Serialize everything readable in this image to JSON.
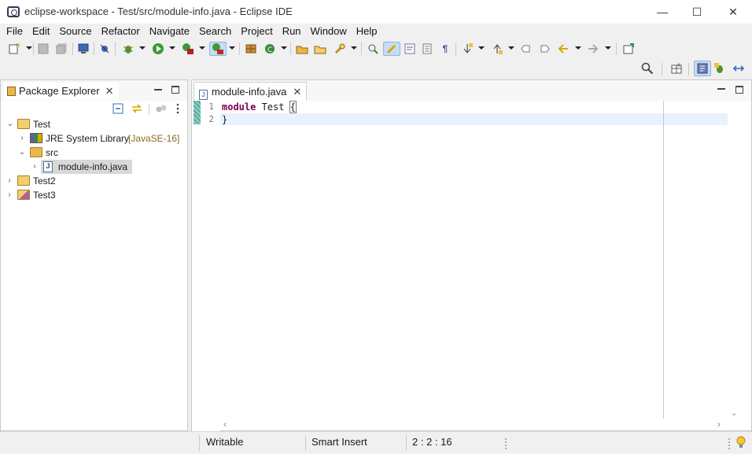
{
  "window": {
    "title": "eclipse-workspace - Test/src/module-info.java - Eclipse IDE",
    "minimize": "—",
    "maximize": "☐",
    "close": "✕"
  },
  "menu": [
    "File",
    "Edit",
    "Source",
    "Refactor",
    "Navigate",
    "Search",
    "Project",
    "Run",
    "Window",
    "Help"
  ],
  "explorer": {
    "title": "Package Explorer",
    "tree": [
      {
        "label": "Test",
        "expanded": true
      },
      {
        "label": "JRE System Library",
        "suffix": "[JavaSE-16]"
      },
      {
        "label": "src",
        "expanded": true
      },
      {
        "label": "module-info.java",
        "selected": true
      },
      {
        "label": "Test2"
      },
      {
        "label": "Test3"
      }
    ]
  },
  "editor": {
    "tab_label": "module-info.java",
    "lines": [
      {
        "num": "1",
        "keyword": "module",
        "rest": " Test ",
        "brace": "{"
      },
      {
        "num": "2",
        "text": "}"
      }
    ]
  },
  "status": {
    "mode": "Writable",
    "insert": "Smart Insert",
    "position": "2 : 2 : 16"
  },
  "colors": {
    "keyword": "#7f0055",
    "current_line": "#e8f2fe",
    "selection_bg": "#d8d8d8"
  }
}
